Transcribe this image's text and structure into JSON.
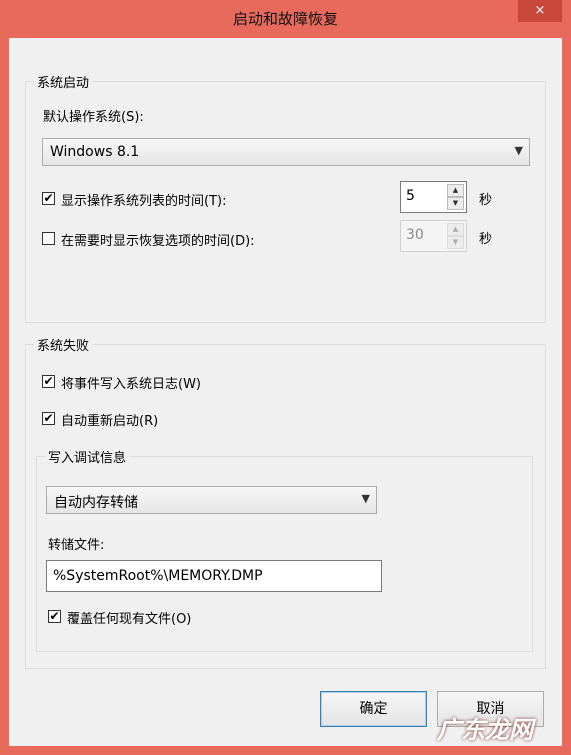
{
  "window": {
    "title": "启动和故障恢复",
    "close_icon": "×"
  },
  "system_startup": {
    "legend": "系统启动",
    "default_os_label": "默认操作系统(S):",
    "default_os_value": "Windows 8.1",
    "show_os_list": {
      "label": "显示操作系统列表的时间(T):",
      "checked": true,
      "value": "5",
      "unit": "秒"
    },
    "show_recovery": {
      "label": "在需要时显示恢复选项的时间(D):",
      "checked": false,
      "value": "30",
      "unit": "秒"
    }
  },
  "system_failure": {
    "legend": "系统失败",
    "write_event_log": {
      "label": "将事件写入系统日志(W)",
      "checked": true
    },
    "auto_restart": {
      "label": "自动重新启动(R)",
      "checked": true
    },
    "debug_info": {
      "legend": "写入调试信息",
      "dump_type": "自动内存转储",
      "dump_file_label": "转储文件:",
      "dump_file_value": "%SystemRoot%\\MEMORY.DMP",
      "overwrite": {
        "label": "覆盖任何现有文件(O)",
        "checked": true
      }
    }
  },
  "buttons": {
    "ok": "确定",
    "cancel": "取消"
  },
  "watermark": {
    "text": "广东龙网"
  },
  "colors": {
    "title_bar": "#e86a5c",
    "close_button": "#c7473a",
    "client_bg": "#f0f0f0"
  }
}
